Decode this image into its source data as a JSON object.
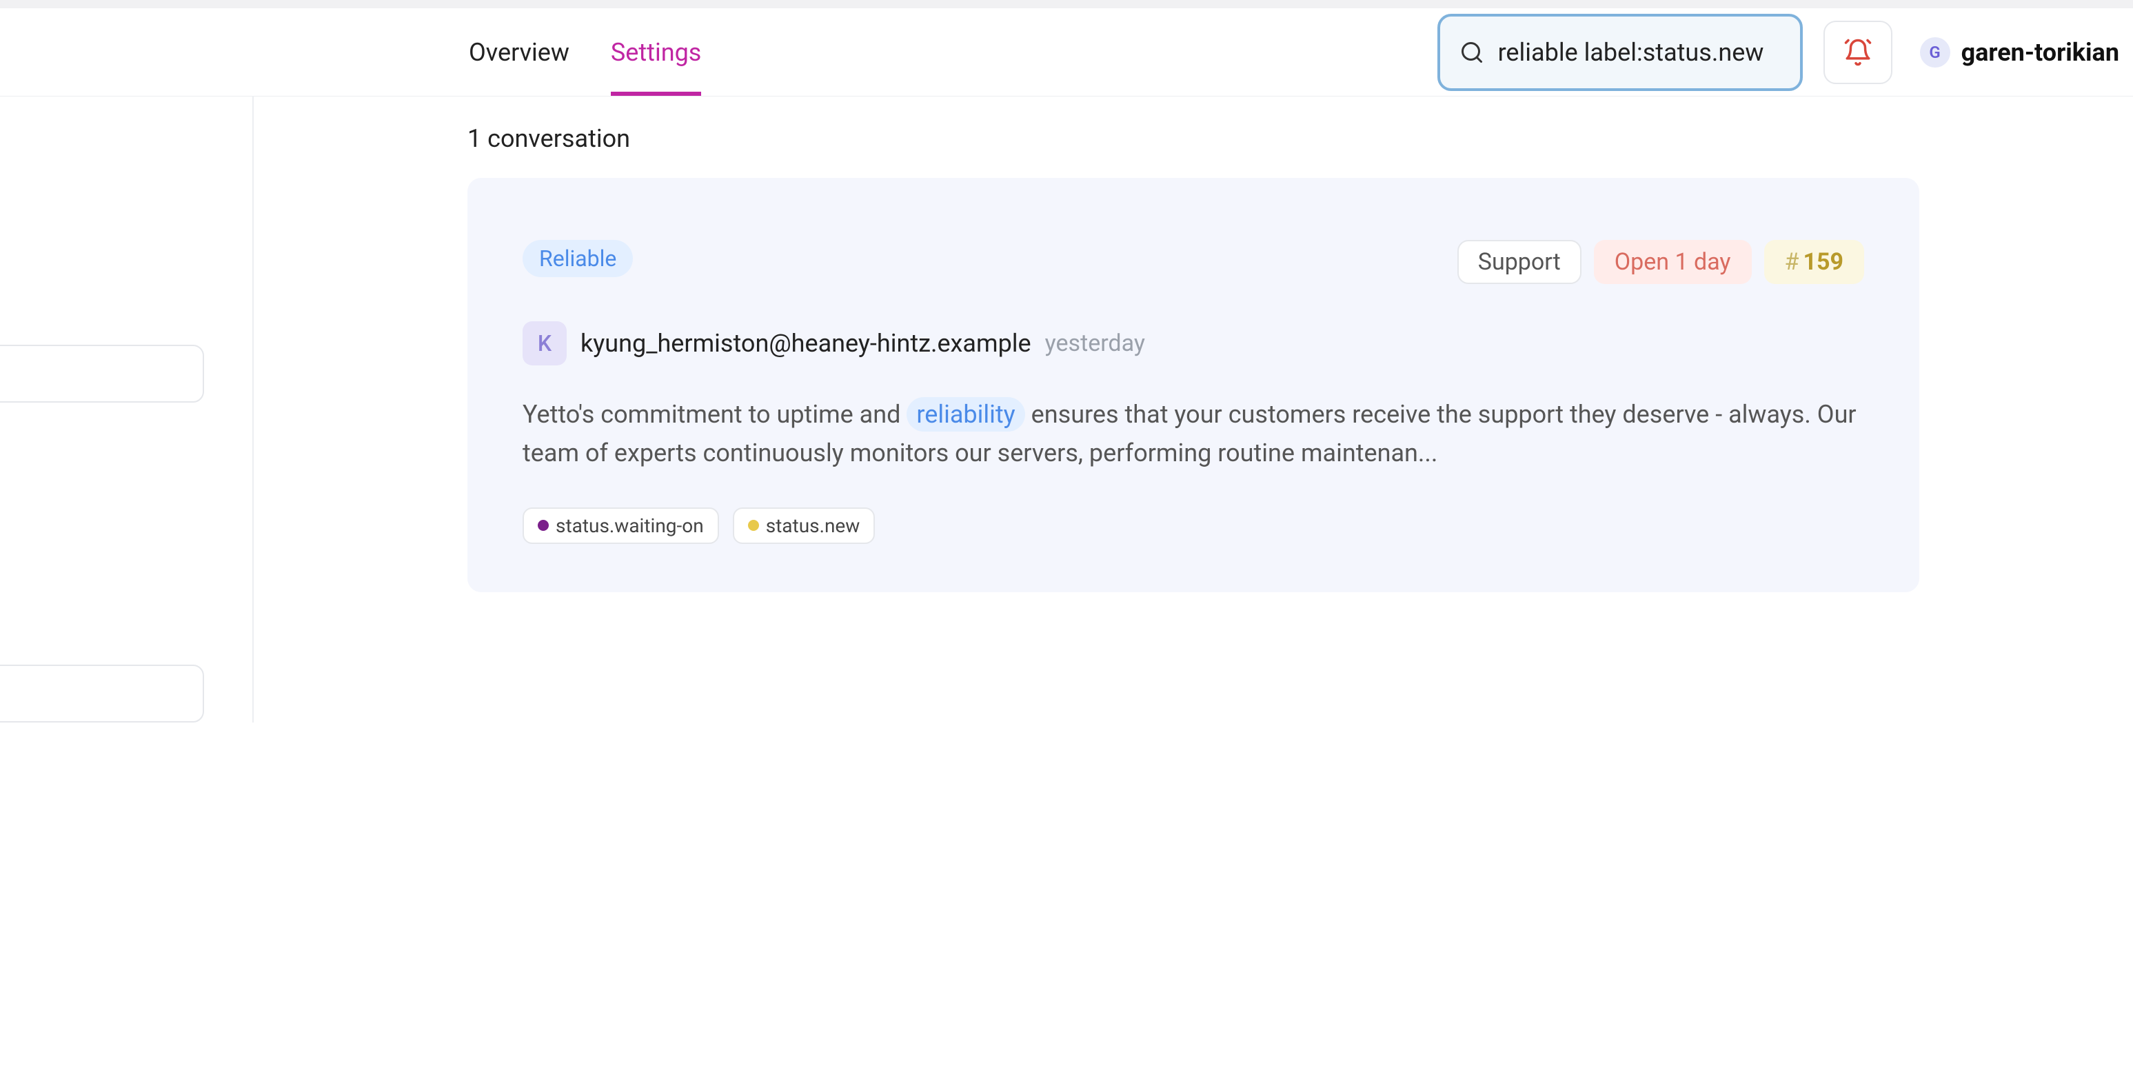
{
  "header": {
    "tabs": {
      "overview": "Overview",
      "settings": "Settings",
      "active": "settings"
    },
    "search": {
      "value": "reliable label:status.new"
    },
    "user": {
      "initial": "G",
      "name": "garen-torikian"
    }
  },
  "results": {
    "count_text": "1 conversation"
  },
  "conversation": {
    "match_tag": "Reliable",
    "badges": {
      "category": "Support",
      "status": "Open 1 day",
      "id_prefix": "#",
      "id": "159"
    },
    "sender": {
      "initial": "K",
      "email": "kyung_hermiston@heaney-hintz.example",
      "time": "yesterday"
    },
    "body": {
      "pre": "Yetto's commitment to uptime and ",
      "highlight": "reliability",
      "post": " ensures that your customers receive the support they deserve - always. Our team of experts continuously monitors our servers, performing routine maintenan..."
    },
    "labels": [
      {
        "name": "status.waiting-on",
        "color": "purple"
      },
      {
        "name": "status.new",
        "color": "yellow"
      }
    ]
  }
}
